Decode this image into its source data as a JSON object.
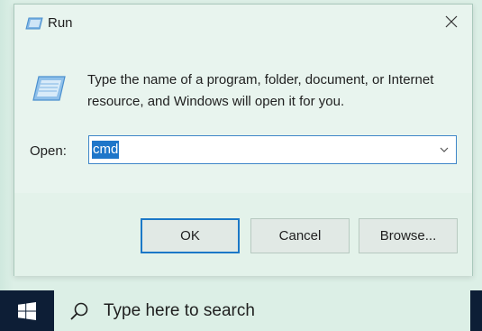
{
  "dialog": {
    "title": "Run",
    "description": "Type the name of a program, folder, document, or Internet resource, and Windows will open it for you.",
    "open_label": "Open:",
    "open_value": "cmd",
    "buttons": {
      "ok": "OK",
      "cancel": "Cancel",
      "browse": "Browse..."
    },
    "icons": {
      "title": "run-icon",
      "close": "close-icon",
      "large": "run-icon",
      "dropdown": "chevron-down-icon"
    }
  },
  "taskbar": {
    "search_placeholder": "Type here to search",
    "icons": {
      "start": "windows-logo-icon",
      "search": "search-icon"
    }
  },
  "colors": {
    "accent": "#1b78c7",
    "selection": "#1f76c9",
    "taskbar": "#0d1e36",
    "dialog_bg": "#e8f4ee"
  }
}
